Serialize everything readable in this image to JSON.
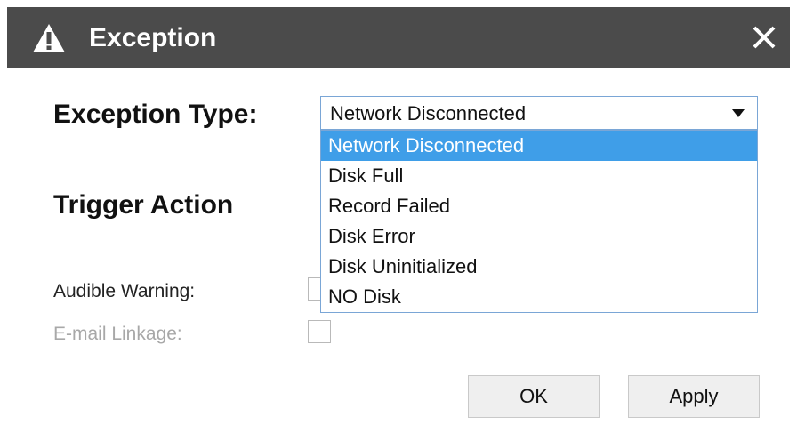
{
  "dialog": {
    "title": "Exception",
    "colors": {
      "titlebar": "#4b4b4b",
      "selected_option": "#3f9ee8",
      "select_border": "#7aa6d6"
    }
  },
  "exception_type": {
    "label": "Exception Type:",
    "selected_value": "Network Disconnected",
    "options": [
      "Network Disconnected",
      "Disk Full",
      "Record Failed",
      "Disk Error",
      "Disk Uninitialized",
      "NO Disk"
    ]
  },
  "trigger_action": {
    "heading": "Trigger Action",
    "audible_warning": {
      "label": "Audible Warning:",
      "checked": false
    },
    "email_linkage": {
      "label": "E-mail Linkage:",
      "checked": false,
      "disabled": true
    }
  },
  "buttons": {
    "ok": "OK",
    "apply": "Apply"
  }
}
